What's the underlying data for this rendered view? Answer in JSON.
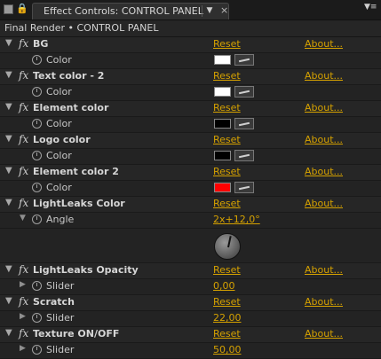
{
  "panel": {
    "tab_label": "Effect Controls: CONTROL PANEL",
    "tab_dropdown_glyph": "▼",
    "tab_close_glyph": "×",
    "menu_glyph": "▼≡"
  },
  "subtitle": "Final Render • CONTROL PANEL",
  "links": {
    "reset": "Reset",
    "about": "About..."
  },
  "fx_label": "fx",
  "effects": [
    {
      "name": "BG",
      "prop": "Color",
      "color": "#ffffff"
    },
    {
      "name": "Text color - 2",
      "prop": "Color",
      "color": "#ffffff"
    },
    {
      "name": "Element color",
      "prop": "Color",
      "color": "#000000"
    },
    {
      "name": "Logo color",
      "prop": "Color",
      "color": "#000000"
    },
    {
      "name": "Element color 2",
      "prop": "Color",
      "color": "#ff0000"
    },
    {
      "name": "LightLeaks Color",
      "prop": "Angle",
      "value": "2x+12,0°",
      "angle_degrees": 12
    },
    {
      "name": "LightLeaks Opacity",
      "prop": "Slider",
      "value": "0,00"
    },
    {
      "name": "Scratch",
      "prop": "Slider",
      "value": "22,00"
    },
    {
      "name": "Texture ON/OFF",
      "prop": "Slider",
      "value": "50,00"
    }
  ],
  "colors": {
    "link": "#d6a200",
    "bg": "#232323"
  }
}
